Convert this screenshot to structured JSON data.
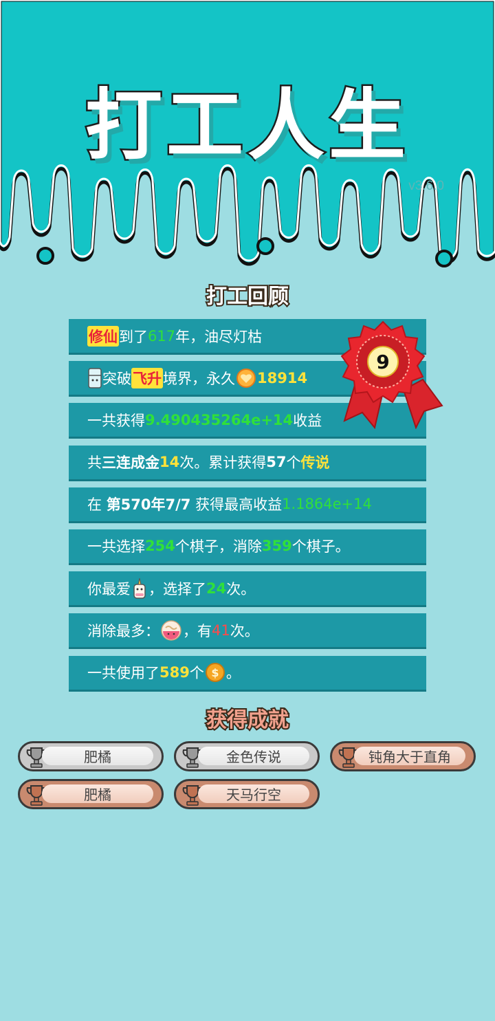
{
  "app": {
    "title": "打工人生",
    "version": "v3.6.0"
  },
  "review": {
    "title": "打工回顾",
    "rank": "9",
    "rows": [
      {
        "realm": "修仙",
        "t1": "到了",
        "years": "617",
        "t2": "年，油尽灯枯"
      },
      {
        "t1": "突破",
        "stage": "飞升",
        "t2": "境界，永久",
        "hearts": "18914"
      },
      {
        "t1": "一共获得",
        "income": "9.490435264e+14",
        "t2": "收益"
      },
      {
        "t1": "共",
        "combo": "三连成金",
        "count": "14",
        "t2": "次。累计获得",
        "legend_count": "57",
        "t3": "个",
        "legend": "传说"
      },
      {
        "t1": "在",
        "date": "第570年7/7",
        "t2": "获得最高收益",
        "max_income": "1.1864e+14"
      },
      {
        "t1": "一共选择",
        "chosen": "254",
        "t2": "个棋子，消除",
        "removed": "359",
        "t3": "个棋子。"
      },
      {
        "t1": "你最爱",
        "t2": "，选择了",
        "times": "24",
        "t3": "次。"
      },
      {
        "t1": "消除最多：",
        "t2": "，有",
        "times": "41",
        "t3": "次。"
      },
      {
        "t1": "一共使用了",
        "coins": "589",
        "t2": "个",
        "t3": "。"
      }
    ]
  },
  "achievements": {
    "title": "获得成就",
    "items": [
      {
        "label": "肥橘",
        "tier": "silver"
      },
      {
        "label": "金色传说",
        "tier": "silver"
      },
      {
        "label": "钝角大于直角",
        "tier": "bronze"
      },
      {
        "label": "肥橘",
        "tier": "bronze"
      },
      {
        "label": "天马行空",
        "tier": "bronze"
      }
    ]
  },
  "colors": {
    "header": "#14c4c6",
    "background": "#9edde2",
    "row": "#1d99a6",
    "green_value": "#30e03a",
    "yellow_value": "#ffe23a",
    "red_value": "#ff4a4a"
  },
  "icons": {
    "rank_badge": "ribbon-rosette-icon",
    "stage": "fridge-spirit-icon",
    "hearts": "heart-coin-icon",
    "favorite": "unicorn-piece-icon",
    "most_removed": "noodle-bowl-icon",
    "coins": "gold-coin-icon",
    "trophy": "trophy-icon"
  }
}
